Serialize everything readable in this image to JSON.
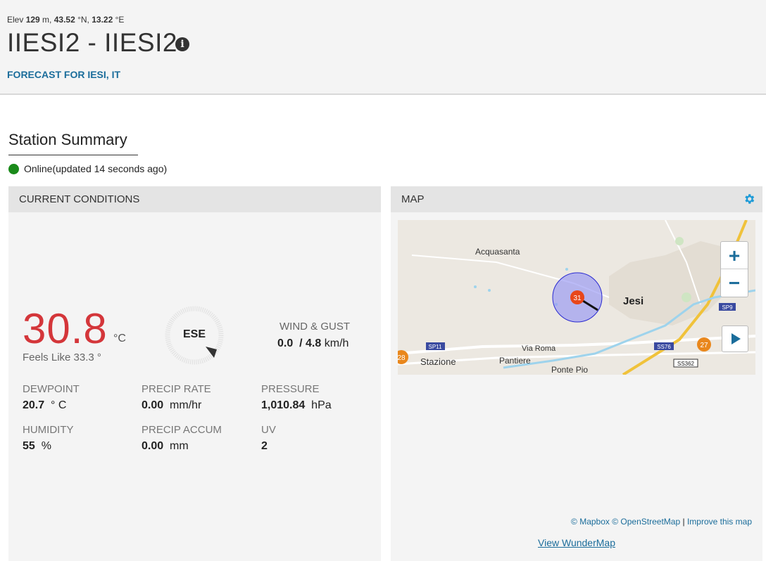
{
  "header": {
    "elev_prefix": "Elev ",
    "elev_value": "129",
    "elev_unit": " m, ",
    "lat_value": "43.52",
    "lat_unit": " °N, ",
    "lon_value": "13.22",
    "lon_unit": " °E",
    "title": "IIESI2 - IIESI2",
    "info_icon": "info-icon",
    "forecast_link": "FORECAST FOR IESI, IT"
  },
  "summary": {
    "title": "Station Summary",
    "status": "Online(updated 14 seconds ago)",
    "status_color": "#1a8a1a"
  },
  "conditions": {
    "header": "CURRENT CONDITIONS",
    "temperature": "30.8",
    "temperature_unit": "°C",
    "feels_like": "Feels Like 33.3 °",
    "wind_direction": "ESE",
    "wind_label": "WIND & GUST",
    "wind_speed": "0.0",
    "wind_gust": "/ 4.8",
    "wind_unit": "km/h",
    "dewpoint_label": "DEWPOINT",
    "dewpoint_value": "20.7",
    "dewpoint_unit": "° C",
    "precip_rate_label": "PRECIP RATE",
    "precip_rate_value": "0.00",
    "precip_rate_unit": "mm/hr",
    "pressure_label": "PRESSURE",
    "pressure_value": "1,010.84",
    "pressure_unit": "hPa",
    "humidity_label": "HUMIDITY",
    "humidity_value": "55",
    "humidity_unit": "%",
    "precip_accum_label": "PRECIP ACCUM",
    "precip_accum_value": "0.00",
    "precip_accum_unit": "mm",
    "uv_label": "UV",
    "uv_value": "2",
    "temp_color": "#d4363a"
  },
  "map": {
    "header": "MAP",
    "settings_icon": "gear-icon",
    "zoom_in": "+",
    "zoom_out": "−",
    "labels": {
      "acquasanta": "Acquasanta",
      "jesi": "Jesi",
      "via_roma": "Via Roma",
      "stazione": "Stazione",
      "pantiere": "Pantiere",
      "ponte_pio": "Ponte Pio",
      "sp11": "SP11",
      "ss76": "SS76",
      "ss362": "SS362",
      "sp9": "SP9"
    },
    "markers": [
      "31",
      "28",
      "27"
    ],
    "credit_mapbox": "© Mapbox",
    "credit_osm": "© OpenStreetMap",
    "credit_sep": "|",
    "credit_improve": "Improve this map",
    "wundermap_link": "View WunderMap"
  }
}
